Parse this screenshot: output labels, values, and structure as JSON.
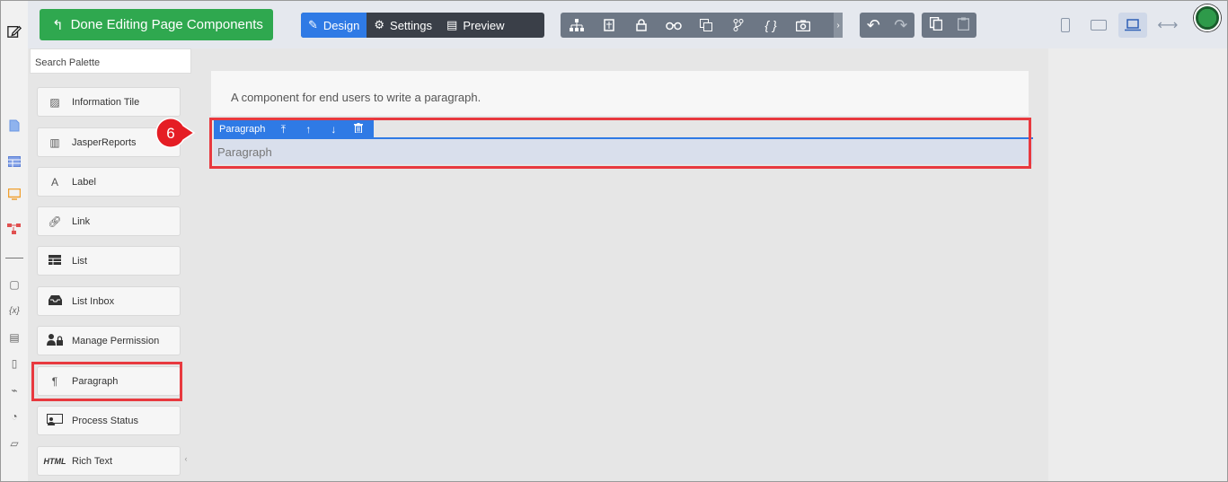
{
  "toolbar": {
    "done_label": "Done Editing Page Components",
    "modes": [
      {
        "label": "Design",
        "active": true
      },
      {
        "label": "Settings",
        "active": false
      },
      {
        "label": "Preview",
        "active": false
      }
    ],
    "tools": [
      "sitemap-icon",
      "page-icon",
      "lock-icon",
      "binoculars-icon",
      "translate-icon",
      "branch-icon",
      "braces-icon",
      "camera-icon"
    ],
    "braces_glyph": "{ }"
  },
  "palette": {
    "search_placeholder": "Search Palette",
    "items": [
      {
        "label": "Information Tile",
        "icon": "image-icon"
      },
      {
        "label": "JasperReports",
        "icon": "report-icon"
      },
      {
        "label": "Label",
        "icon": "label-icon",
        "glyph": "A"
      },
      {
        "label": "Link",
        "icon": "link-icon"
      },
      {
        "label": "List",
        "icon": "list-icon"
      },
      {
        "label": "List Inbox",
        "icon": "inbox-icon"
      },
      {
        "label": "Manage Permission",
        "icon": "permission-icon"
      },
      {
        "label": "Paragraph",
        "icon": "paragraph-icon"
      },
      {
        "label": "Process Status",
        "icon": "process-status-icon"
      },
      {
        "label": "Rich Text",
        "icon": "html-icon",
        "glyph": "HTML"
      }
    ]
  },
  "canvas": {
    "description": "A component for end users to write a paragraph.",
    "component_label": "Paragraph",
    "component_text": "Paragraph"
  },
  "callout": {
    "number": "6"
  },
  "colors": {
    "accent": "#2f7ae5",
    "done_green": "#2fa84f",
    "highlight_red": "#e8393f"
  }
}
